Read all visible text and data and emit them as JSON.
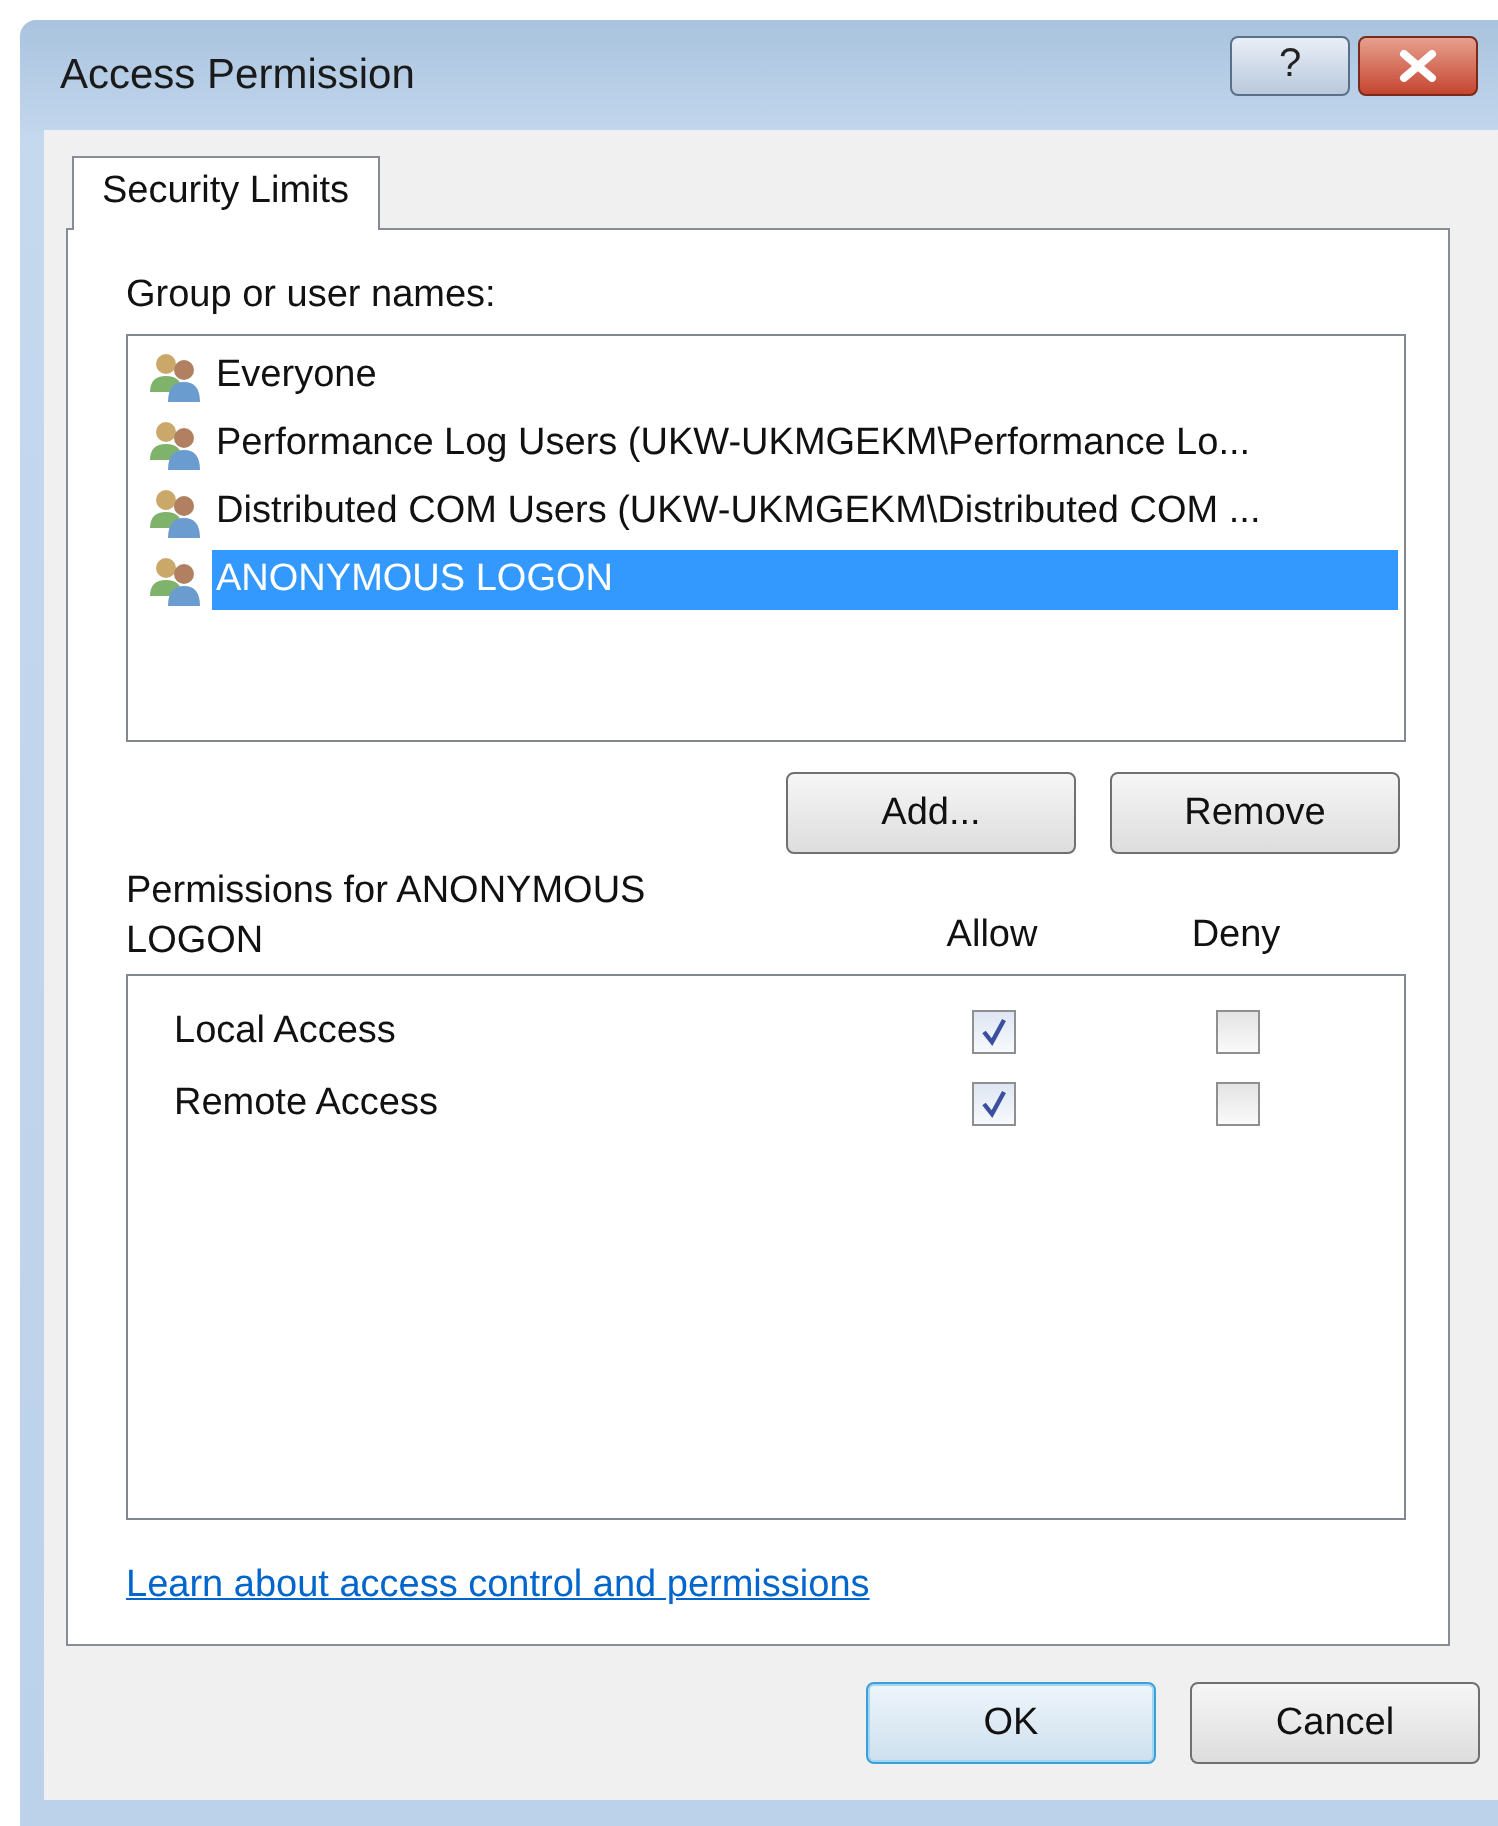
{
  "window": {
    "title": "Access Permission",
    "help_button": "?"
  },
  "tabs": [
    {
      "label": "Security Limits",
      "selected": true
    }
  ],
  "group_label": "Group or user names:",
  "users": [
    {
      "name": "Everyone",
      "selected": false
    },
    {
      "name": "Performance Log Users (UKW-UKMGEKM\\Performance Lo...",
      "selected": false
    },
    {
      "name": "Distributed COM Users (UKW-UKMGEKM\\Distributed COM ...",
      "selected": false
    },
    {
      "name": "ANONYMOUS LOGON",
      "selected": true
    }
  ],
  "list_buttons": [
    "Add...",
    "Remove"
  ],
  "permissions": {
    "label": "Permissions for ANONYMOUS LOGON",
    "allow_header": "Allow",
    "deny_header": "Deny",
    "rows": [
      {
        "name": "Local Access",
        "allow": true,
        "deny": false
      },
      {
        "name": "Remote Access",
        "allow": true,
        "deny": false
      }
    ]
  },
  "link": "Learn about access control and permissions",
  "buttons": [
    {
      "label": "OK",
      "default": true
    },
    {
      "label": "Cancel",
      "default": false
    }
  ]
}
